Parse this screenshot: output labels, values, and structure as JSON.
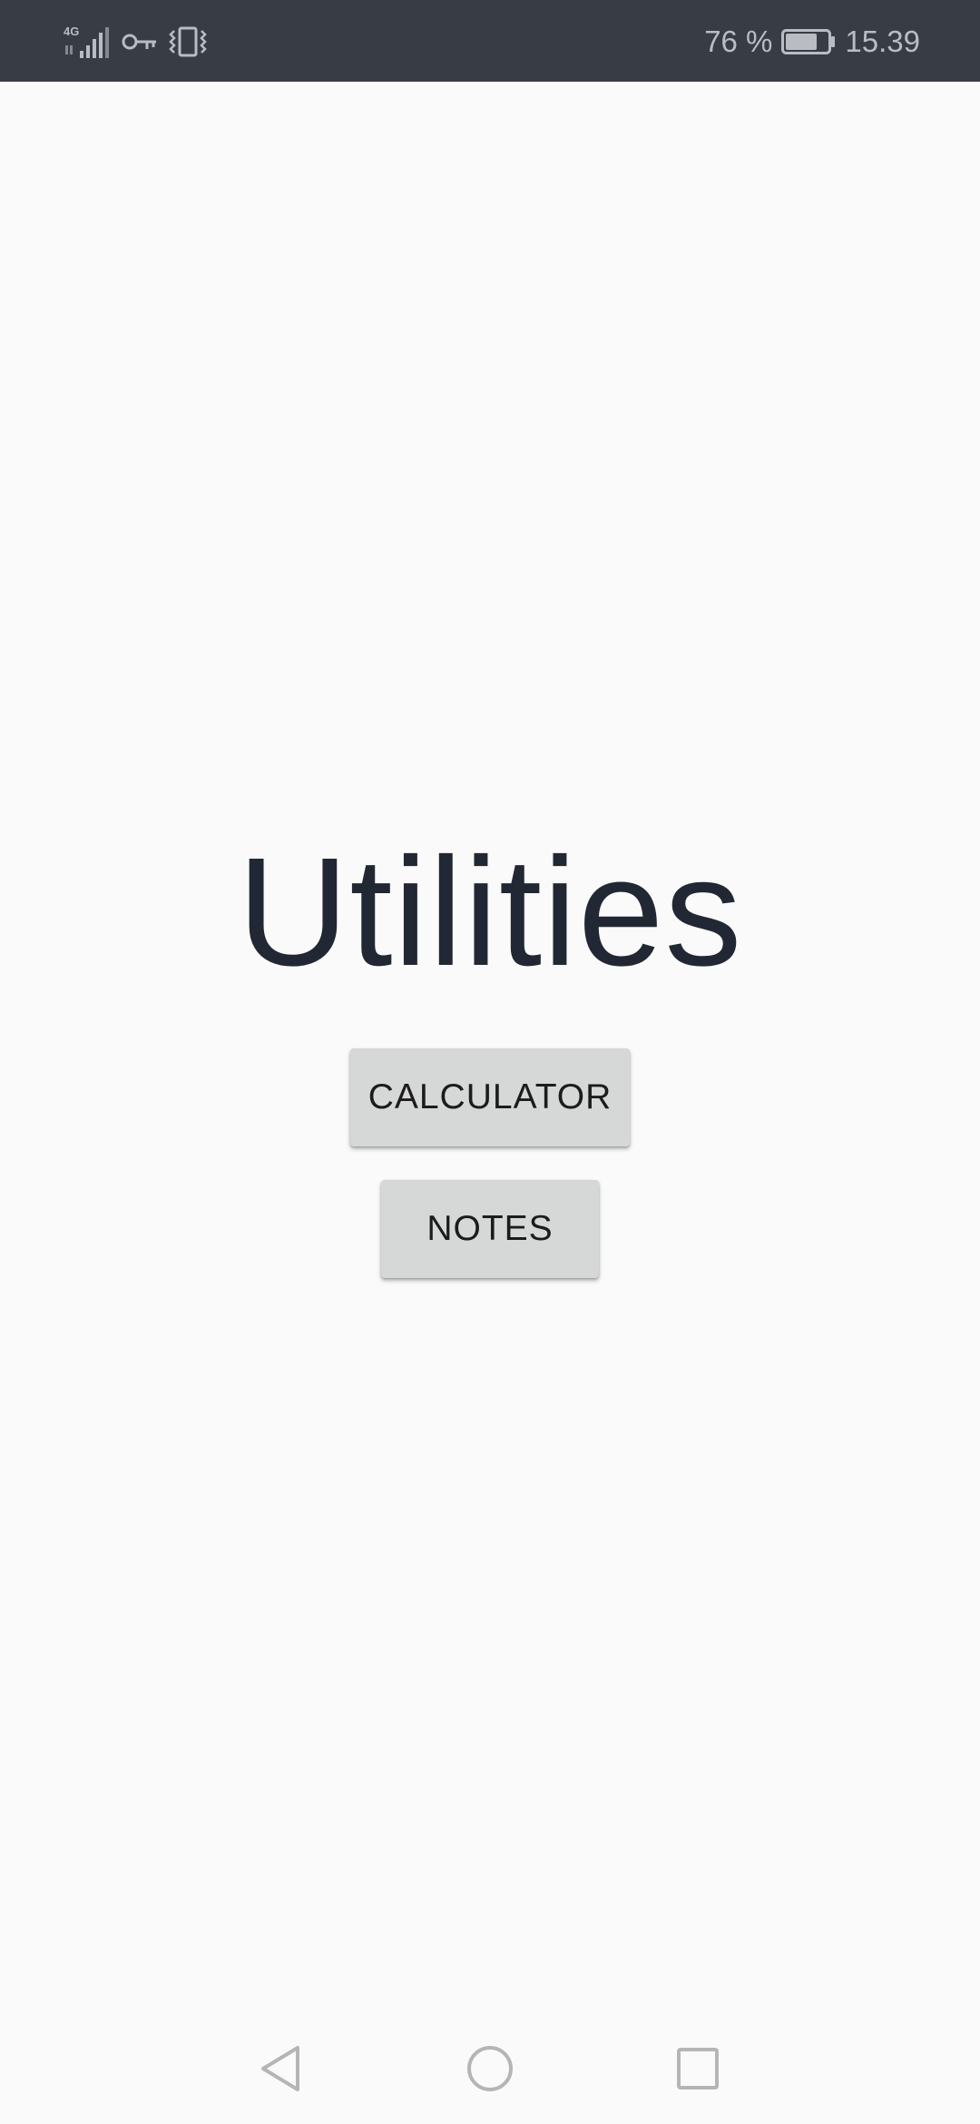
{
  "status_bar": {
    "network_label": "4G",
    "battery_percent": "76 %",
    "battery_level": 0.76,
    "time": "15.39",
    "icons": [
      "signal-icon",
      "vpn-key-icon",
      "vibrate-icon",
      "battery-icon"
    ]
  },
  "main": {
    "title": "Utilities",
    "buttons": {
      "calculator": "CALCULATOR",
      "notes": "NOTES"
    }
  },
  "nav_bar": {
    "icons": [
      "back-icon",
      "home-icon",
      "recents-icon"
    ]
  },
  "colors": {
    "status_bar_bg": "#383c45",
    "background": "#fafafa",
    "title_text": "#222833",
    "button_bg": "#d6d7d7"
  }
}
